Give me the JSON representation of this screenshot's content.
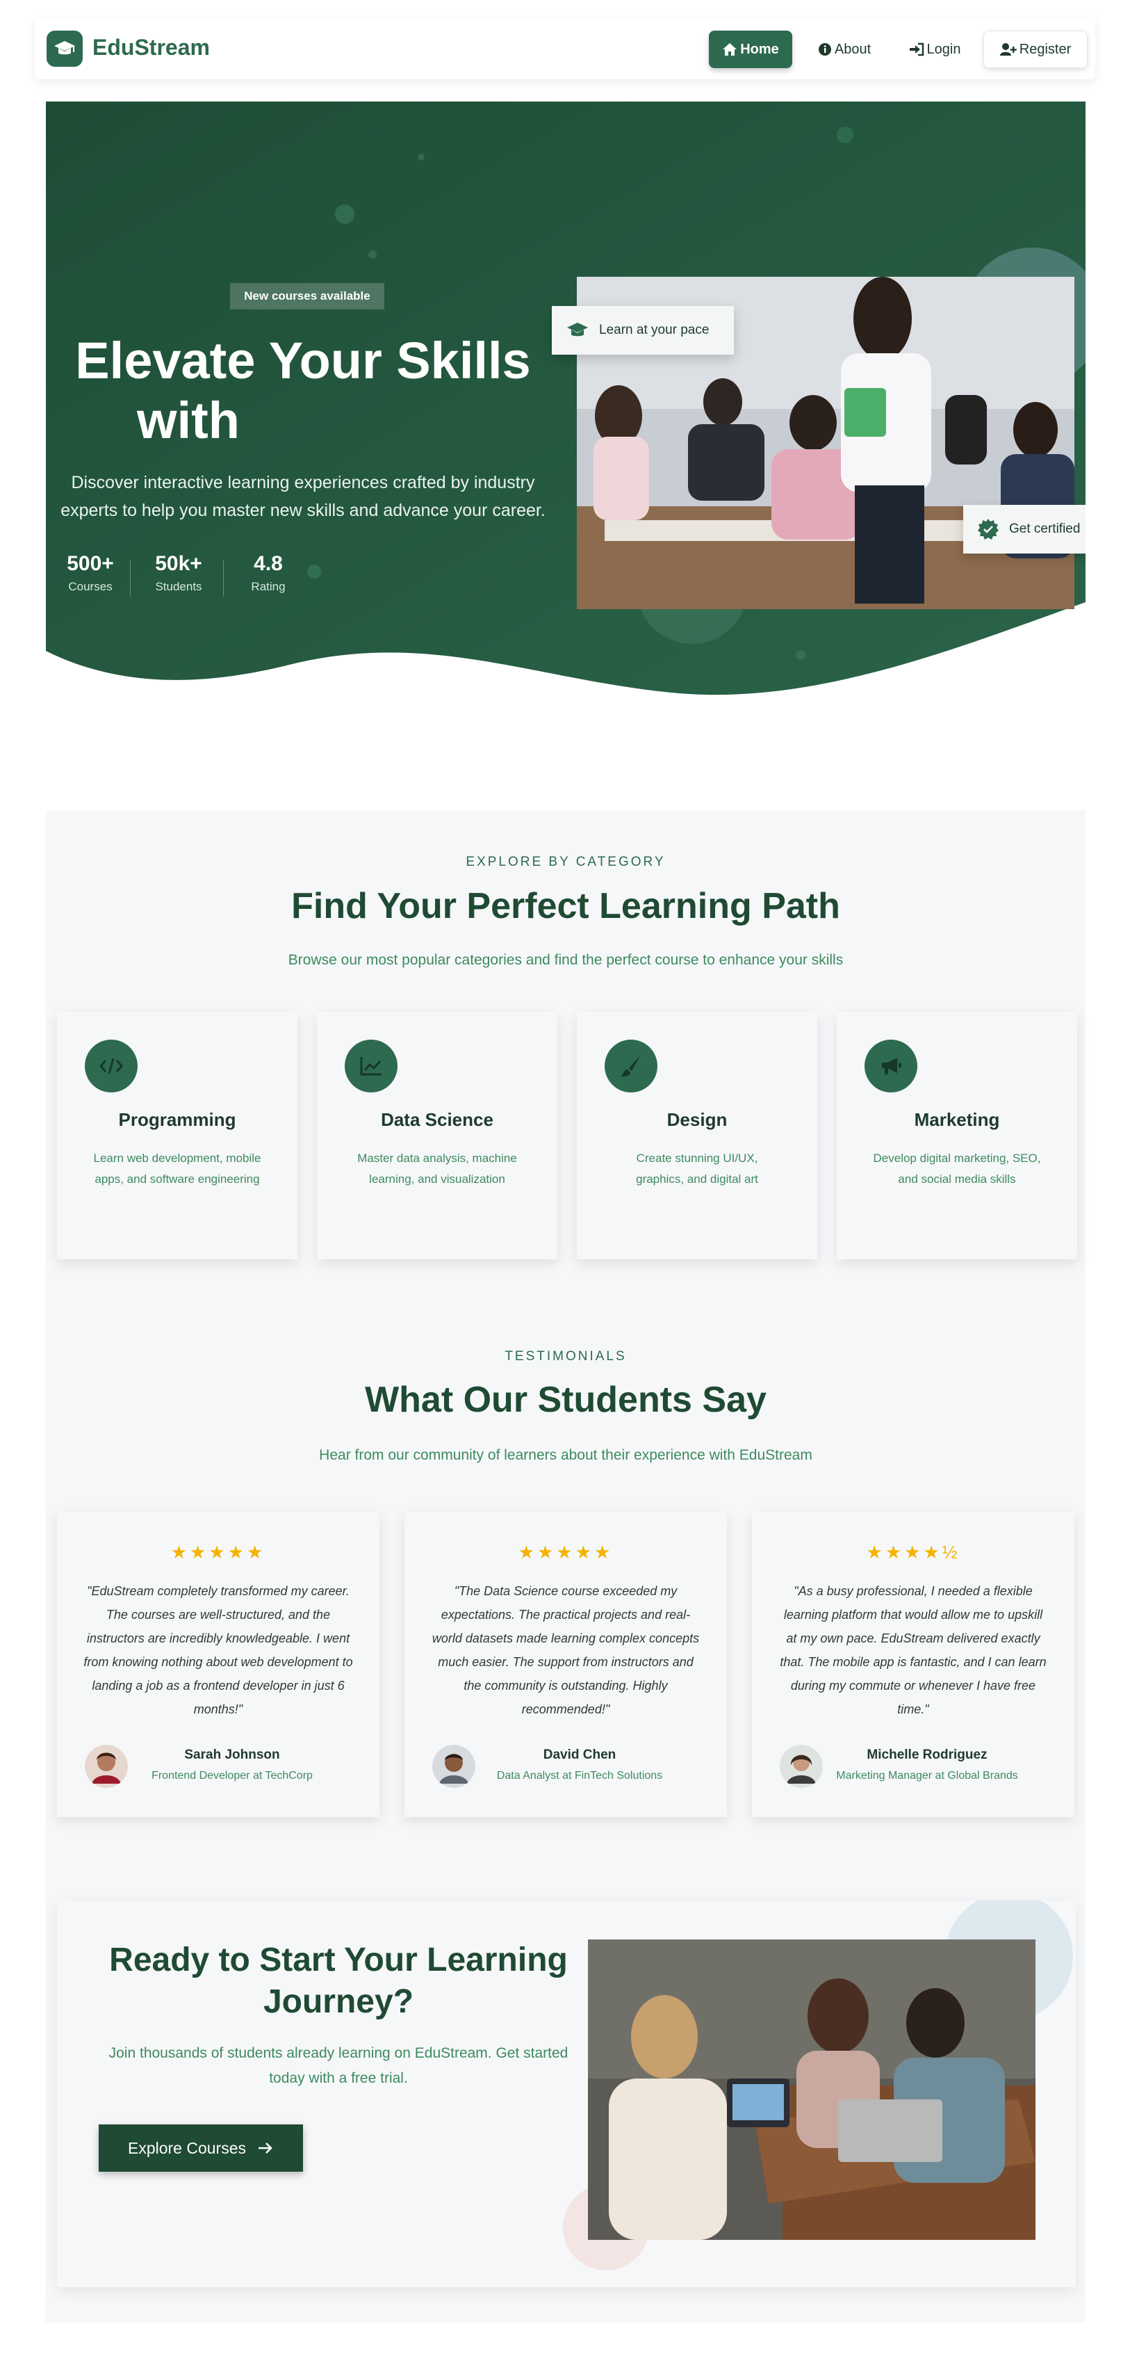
{
  "nav": {
    "brand": "EduStream",
    "home": "Home",
    "about": "About",
    "login": "Login",
    "register": "Register"
  },
  "hero": {
    "badge": "New courses available",
    "title_line1": "Elevate Your Skills",
    "title_line2": "with",
    "subtitle": "Discover interactive learning experiences crafted by industry experts to help you master new skills and advance your career.",
    "stats": [
      {
        "value": "500+",
        "label": "Courses"
      },
      {
        "value": "50k+",
        "label": "Students"
      },
      {
        "value": "4.8",
        "label": "Rating"
      }
    ],
    "float_card_1": "Learn at your pace",
    "float_card_2": "Get certified"
  },
  "categories": {
    "eyebrow": "EXPLORE BY CATEGORY",
    "title": "Find Your Perfect Learning Path",
    "subtitle": "Browse our most popular categories and find the perfect course to enhance your skills",
    "items": [
      {
        "title": "Programming",
        "desc": "Learn web development, mobile apps, and software engineering",
        "icon": "code-icon"
      },
      {
        "title": "Data Science",
        "desc": "Master data analysis, machine learning, and visualization",
        "icon": "chart-icon"
      },
      {
        "title": "Design",
        "desc": "Create stunning UI/UX, graphics, and digital art",
        "icon": "brush-icon"
      },
      {
        "title": "Marketing",
        "desc": "Develop digital marketing, SEO, and social media skills",
        "icon": "megaphone-icon"
      }
    ]
  },
  "testimonials": {
    "eyebrow": "TESTIMONIALS",
    "title": "What Our Students Say",
    "subtitle": "Hear from our community of learners about their experience with EduStream",
    "items": [
      {
        "stars": "★★★★★",
        "quote": "\"EduStream completely transformed my career. The courses are well-structured, and the instructors are incredibly knowledgeable. I went from knowing nothing about web development to landing a job as a frontend developer in just 6 months!\"",
        "name": "Sarah Johnson",
        "role": "Frontend Developer at TechCorp"
      },
      {
        "stars": "★★★★★",
        "quote": "\"The Data Science course exceeded my expectations. The practical projects and real-world datasets made learning complex concepts much easier. The support from instructors and the community is outstanding. Highly recommended!\"",
        "name": "David Chen",
        "role": "Data Analyst at FinTech Solutions"
      },
      {
        "stars": "★★★★½",
        "quote": "\"As a busy professional, I needed a flexible learning platform that would allow me to upskill at my own pace. EduStream delivered exactly that. The mobile app is fantastic, and I can learn during my commute or whenever I have free time.\"",
        "name": "Michelle Rodriguez",
        "role": "Marketing Manager at Global Brands"
      }
    ]
  },
  "cta": {
    "title": "Ready to Start Your Learning Journey?",
    "subtitle": "Join thousands of students already learning on EduStream. Get started today with a free trial.",
    "button": "Explore Courses"
  },
  "colors": {
    "primary": "#2d6a4f",
    "dark": "#1f4a33",
    "star": "#f5b301",
    "section_bg": "#f6f7f9"
  }
}
